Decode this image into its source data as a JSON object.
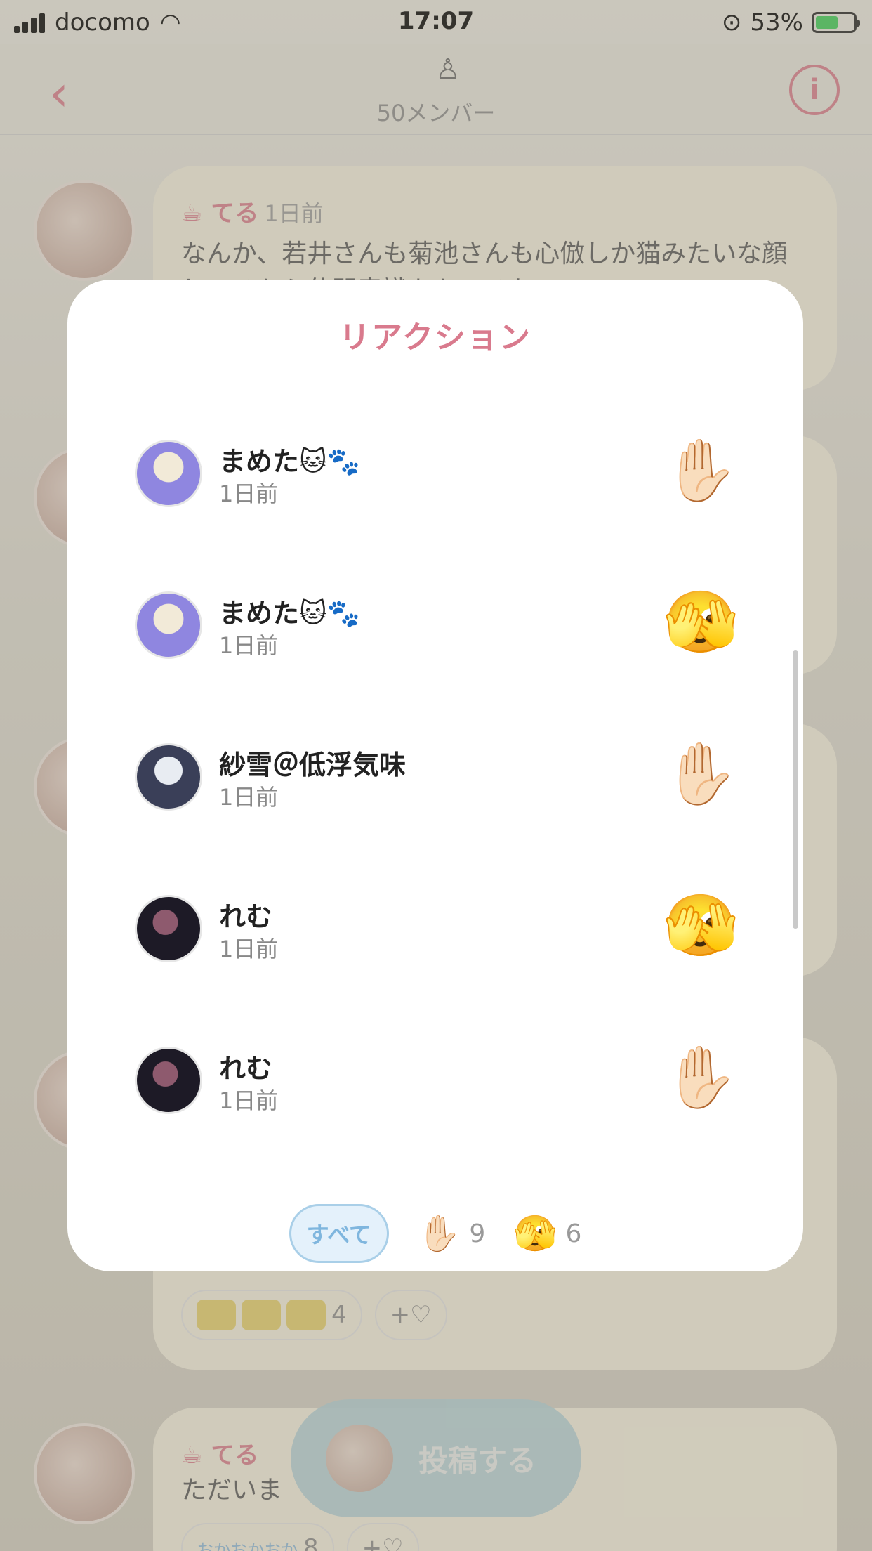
{
  "status": {
    "carrier": "docomo",
    "time": "17:07",
    "battery": "53%",
    "battery_level": 0.53
  },
  "nav": {
    "back_icon": "chevron-left-icon",
    "members": "50メンバー",
    "info_icon": "info-icon"
  },
  "background_feed": [
    {
      "name": "てる",
      "ago": "1日前",
      "text": "なんか、若井さんも菊池さんも心倣しか猫みたいな顔してるから仕間意識をもてるな。。。。"
    },
    {
      "chip_count": "4",
      "chip_add": "+♡"
    },
    {
      "name": "てる",
      "ago": "",
      "text": "ただいま",
      "chip_text": "おかおかおか",
      "chip_count": "8",
      "chip_add": "+♡"
    }
  ],
  "post_button": {
    "label": "投稿する"
  },
  "modal": {
    "title": "リアクション",
    "reactions": [
      {
        "name": "まめた🐱🐾",
        "time": "1日前",
        "emoji": "✋🏻"
      },
      {
        "name": "まめた🐱🐾",
        "time": "1日前",
        "emoji": "🫣"
      },
      {
        "name": "紗雪＠低浮気味",
        "time": "1日前",
        "emoji": "✋🏻"
      },
      {
        "name": "れむ",
        "time": "1日前",
        "emoji": "🫣"
      },
      {
        "name": "れむ",
        "time": "1日前",
        "emoji": "✋🏻"
      }
    ],
    "tabs": {
      "all_label": "すべて",
      "hand_emoji": "✋🏻",
      "hand_count": "9",
      "peek_emoji": "🫣",
      "peek_count": "6"
    }
  }
}
